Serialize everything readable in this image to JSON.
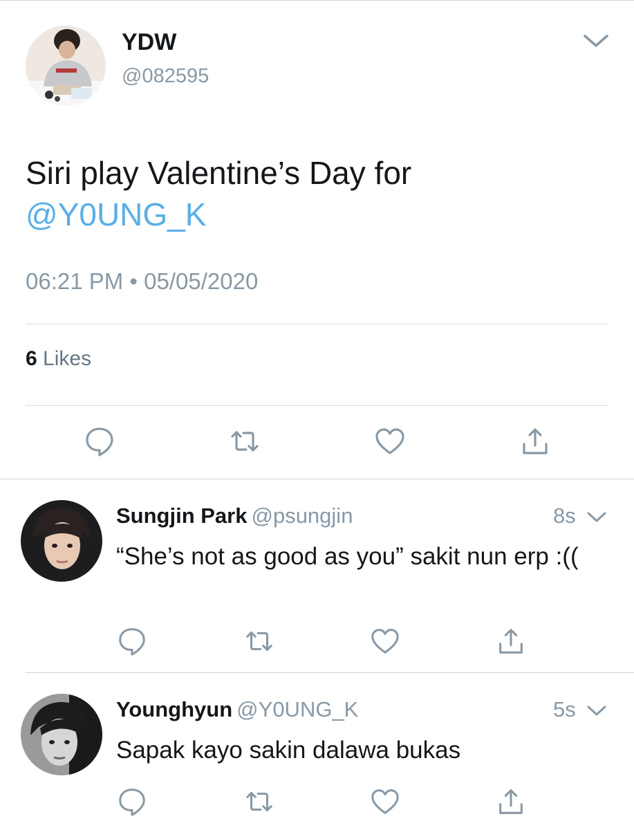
{
  "tweet": {
    "author_name": "YDW",
    "author_handle": "@082595",
    "text": "Siri play Valentine’s Day for",
    "mention": "@Y0UNG_K",
    "timestamp": "06:21 PM • 05/05/2020",
    "likes_count": "6",
    "likes_label": "Likes"
  },
  "replies": [
    {
      "name": "Sungjin Park",
      "handle": "@psungjin",
      "time": "8s",
      "text": "“She’s not as good as you” sakit nun erp :(("
    },
    {
      "name": "Younghyun",
      "handle": "@Y0UNG_K",
      "time": "5s",
      "text": "Sapak kayo sakin dalawa bukas"
    }
  ],
  "icons": [
    "reply-icon",
    "retweet-icon",
    "like-icon",
    "share-icon",
    "chevron-down-icon"
  ],
  "colors": {
    "mention": "#5aaee6",
    "secondary_text": "#8899a6",
    "icon": "#8899a6"
  }
}
